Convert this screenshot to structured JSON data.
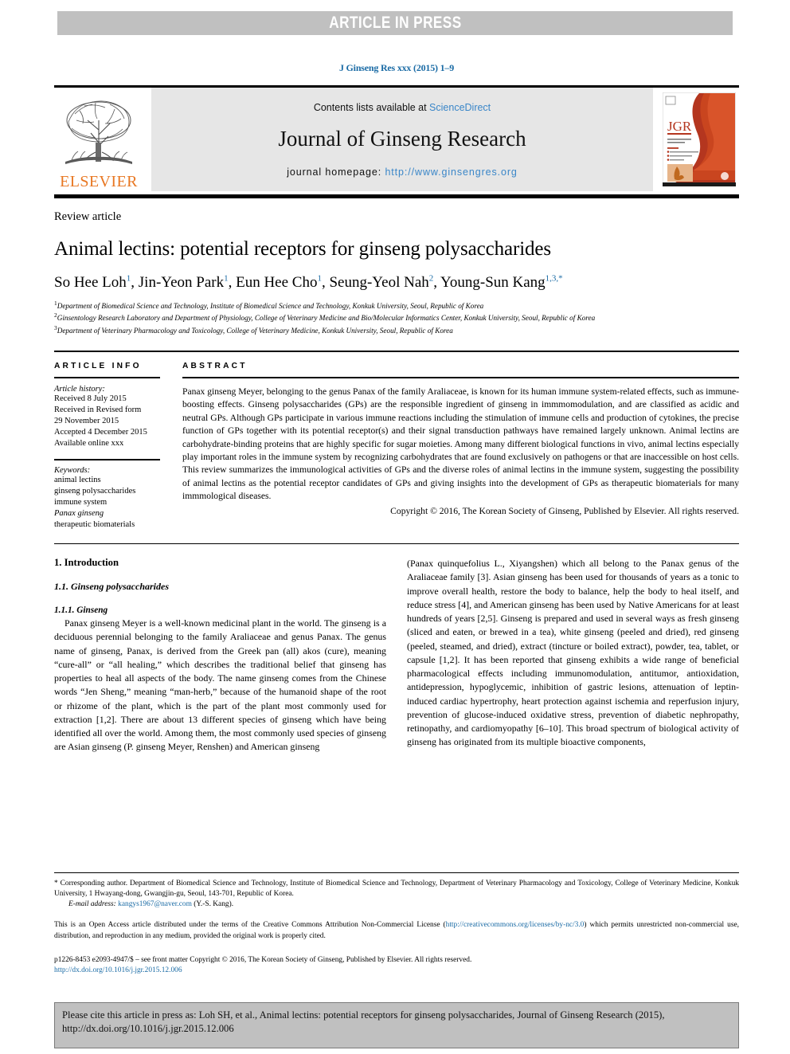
{
  "banner": {
    "label": "ARTICLE IN PRESS"
  },
  "header": {
    "journal_ref": "J Ginseng Res xxx (2015) 1–9",
    "contents_prefix": "Contents lists available at ",
    "contents_link": "ScienceDirect",
    "journal_name": "Journal of Ginseng Research",
    "homepage_prefix": "journal homepage: ",
    "homepage_url": "http://www.ginsengres.org",
    "publisher_logo": "ELSEVIER",
    "cover_badge": "JGR"
  },
  "article": {
    "kind": "Review article",
    "title": "Animal lectins: potential receptors for ginseng polysaccharides",
    "authors": [
      {
        "name": "So Hee Loh",
        "sup": "1",
        "sep": ", "
      },
      {
        "name": "Jin-Yeon Park",
        "sup": "1",
        "sep": ", "
      },
      {
        "name": "Eun Hee Cho",
        "sup": "1",
        "sep": ", "
      },
      {
        "name": "Seung-Yeol Nah",
        "sup": "2",
        "sep": ", "
      },
      {
        "name": "Young-Sun Kang",
        "sup": "1,3,*",
        "sep": ""
      }
    ],
    "affiliations": [
      {
        "sup": "1",
        "text": "Department of Biomedical Science and Technology, Institute of Biomedical Science and Technology, Konkuk University, Seoul, Republic of Korea"
      },
      {
        "sup": "2",
        "text": "Ginsentology Research Laboratory and Department of Physiology, College of Veterinary Medicine and Bio/Molecular Informatics Center, Konkuk University, Seoul, Republic of Korea"
      },
      {
        "sup": "3",
        "text": "Department of Veterinary Pharmacology and Toxicology, College of Veterinary Medicine, Konkuk University, Seoul, Republic of Korea"
      }
    ]
  },
  "article_info": {
    "heading": "ARTICLE INFO",
    "history_label": "Article history:",
    "history": [
      "Received 8 July 2015",
      "Received in Revised form",
      "29 November 2015",
      "Accepted 4 December 2015",
      "Available online xxx"
    ],
    "keywords_label": "Keywords:",
    "keywords": [
      {
        "text": "animal lectins",
        "italic": false
      },
      {
        "text": "ginseng polysaccharides",
        "italic": false
      },
      {
        "text": "immune system",
        "italic": false
      },
      {
        "text": "Panax ginseng",
        "italic": true
      },
      {
        "text": "therapeutic biomaterials",
        "italic": false
      }
    ]
  },
  "abstract": {
    "heading": "ABSTRACT",
    "body": "Panax ginseng Meyer, belonging to the genus Panax of the family Araliaceae, is known for its human immune system-related effects, such as immune-boosting effects. Ginseng polysaccharides (GPs) are the responsible ingredient of ginseng in immmomodulation, and are classified as acidic and neutral GPs. Although GPs participate in various immune reactions including the stimulation of immune cells and production of cytokines, the precise function of GPs together with its potential receptor(s) and their signal transduction pathways have remained largely unknown. Animal lectins are carbohydrate-binding proteins that are highly specific for sugar moieties. Among many different biological functions in vivo, animal lectins especially play important roles in the immune system by recognizing carbohydrates that are found exclusively on pathogens or that are inaccessible on host cells. This review summarizes the immunological activities of GPs and the diverse roles of animal lectins in the immune system, suggesting the possibility of animal lectins as the potential receptor candidates of GPs and giving insights into the development of GPs as therapeutic biomaterials for many immmological diseases.",
    "copyright": "Copyright © 2016, The Korean Society of Ginseng, Published by Elsevier. All rights reserved."
  },
  "body": {
    "section_1": "1. Introduction",
    "section_1_1": "1.1. Ginseng polysaccharides",
    "section_1_1_1": "1.1.1. Ginseng",
    "left_paragraph": "Panax ginseng Meyer is a well-known medicinal plant in the world. The ginseng is a deciduous perennial belonging to the family Araliaceae and genus Panax. The genus name of ginseng, Panax, is derived from the Greek pan (all) akos (cure), meaning “cure-all” or “all healing,” which describes the traditional belief that ginseng has properties to heal all aspects of the body. The name ginseng comes from the Chinese words “Jen Sheng,” meaning “man-herb,” because of the humanoid shape of the root or rhizome of the plant, which is the part of the plant most commonly used for extraction [1,2]. There are about 13 different species of ginseng which have being identified all over the world. Among them, the most commonly used species of ginseng are Asian ginseng (P. ginseng Meyer, Renshen) and American ginseng",
    "right_paragraph": "(Panax quinquefolius L., Xiyangshen) which all belong to the Panax genus of the Araliaceae family [3]. Asian ginseng has been used for thousands of years as a tonic to improve overall health, restore the body to balance, help the body to heal itself, and reduce stress [4], and American ginseng has been used by Native Americans for at least hundreds of years [2,5]. Ginseng is prepared and used in several ways as fresh ginseng (sliced and eaten, or brewed in a tea), white ginseng (peeled and dried), red ginseng (peeled, steamed, and dried), extract (tincture or boiled extract), powder, tea, tablet, or capsule [1,2]. It has been reported that ginseng exhibits a wide range of beneficial pharmacological effects including immunomodulation, antitumor, antioxidation, antidepression, hypoglycemic, inhibition of gastric lesions, attenuation of leptin-induced cardiac hypertrophy, heart protection against ischemia and reperfusion injury, prevention of glucose-induced oxidative stress, prevention of diabetic nephropathy, retinopathy, and cardiomyopathy [6–10]. This broad spectrum of biological activity of ginseng has originated from its multiple bioactive components,"
  },
  "footnotes": {
    "corresponding": "* Corresponding author. Department of Biomedical Science and Technology, Institute of Biomedical Science and Technology, Department of Veterinary Pharmacology and Toxicology, College of Veterinary Medicine, Konkuk University, 1 Hwayang-dong, Gwangjin-gu, Seoul, 143-701, Republic of Korea.",
    "email_label": "E-mail address:",
    "email": "kangys1967@naver.com",
    "email_suffix": "(Y.-S. Kang).",
    "open_access_pre": "This is an Open Access article distributed under the terms of the Creative Commons Attribution Non-Commercial License (",
    "open_access_link": "http://creativecommons.org/licenses/by-nc/3.0",
    "open_access_post": ") which permits unrestricted non-commercial use, distribution, and reproduction in any medium, provided the original work is properly cited.",
    "issn_line": "p1226-8453 e2093-4947/$ – see front matter Copyright © 2016, The Korean Society of Ginseng, Published by Elsevier. All rights reserved.",
    "doi": "http://dx.doi.org/10.1016/j.jgr.2015.12.006"
  },
  "cite_box": {
    "text": "Please cite this article in press as: Loh SH, et al., Animal lectins: potential receptors for ginseng polysaccharides, Journal of Ginseng Research (2015), http://dx.doi.org/10.1016/j.jgr.2015.12.006"
  },
  "colors": {
    "link": "#1a6ba5",
    "elsevier_orange": "#E87722",
    "banner_gray": "#c0c0c0",
    "band_gray": "#e6e6e6"
  }
}
